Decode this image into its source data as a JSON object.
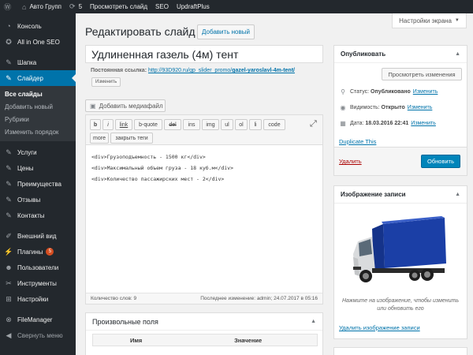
{
  "adminbar": {
    "site_name": "Авто Групп",
    "updates_count": "5",
    "view_slide": "Просмотреть слайд",
    "seo": "SEO",
    "updraft": "UpdraftPlus"
  },
  "sidebar": {
    "items": [
      {
        "label": "Консоль",
        "icon": "dashboard-icon"
      },
      {
        "label": "All in One SEO",
        "icon": "seo-icon"
      },
      {
        "label": "Шапка",
        "icon": "header-icon"
      },
      {
        "label": "Слайдер",
        "icon": "slider-icon"
      },
      {
        "label": "Услуги",
        "icon": "pin-icon"
      },
      {
        "label": "Цены",
        "icon": "pin-icon"
      },
      {
        "label": "Преимущества",
        "icon": "pin-icon"
      },
      {
        "label": "Отзывы",
        "icon": "pin-icon"
      },
      {
        "label": "Контакты",
        "icon": "pin-icon"
      },
      {
        "label": "Внешний вид",
        "icon": "appearance-icon"
      },
      {
        "label": "Плагины",
        "icon": "plugins-icon",
        "badge": "5"
      },
      {
        "label": "Пользователи",
        "icon": "users-icon"
      },
      {
        "label": "Инструменты",
        "icon": "tools-icon"
      },
      {
        "label": "Настройки",
        "icon": "settings-icon"
      },
      {
        "label": "FileManager",
        "icon": "filemanager-icon"
      },
      {
        "label": "Свернуть меню",
        "icon": "collapse-icon"
      }
    ],
    "submenu": [
      "Все слайды",
      "Добавить новый",
      "Рубрики",
      "Изменить порядок"
    ]
  },
  "screen_options": "Настройки экрана",
  "page": {
    "title": "Редактировать слайд",
    "add_new": "Добавить новый"
  },
  "post": {
    "title": "Удлиненная газель (4м) тент",
    "permalink_label": "Постоянная ссылка:",
    "permalink_url": "http://93D920.ru/gp_slider_promo/",
    "permalink_slug": "gazel-yaroslavl-4m-tent/",
    "edit_slug": "Изменить"
  },
  "editor": {
    "add_media": "Добавить медиафайл",
    "buttons": [
      "b",
      "i",
      "link",
      "b-quote",
      "del",
      "ins",
      "img",
      "ul",
      "ol",
      "li",
      "code",
      "more",
      "закрыть теги"
    ],
    "content_lines": [
      "<div>Грузоподъемность - 1500 кг</div>",
      "<div>Максимальный объем груза - 18 куб.м</div>",
      "<div>Количество пассажирских мест - 2</div>"
    ],
    "word_count": "Количество слов: 9",
    "last_edit": "Последнее изменение: admin; 24.07.2017 в 05:16"
  },
  "custom_fields": {
    "title": "Произвольные поля",
    "col_name": "Имя",
    "col_value": "Значение"
  },
  "publish": {
    "title": "Опубликовать",
    "preview": "Просмотреть изменения",
    "status_label": "Статус:",
    "status_value": "Опубликовано",
    "visibility_label": "Видимость:",
    "visibility_value": "Открыто",
    "date_label": "Дата:",
    "date_value": "18.03.2016 22:41",
    "edit_link": "Изменить",
    "duplicate": "Duplicate This",
    "trash": "Удалить",
    "update": "Обновить"
  },
  "thumbnail": {
    "title": "Изображение записи",
    "hint": "Нажмите на изображение, чтобы изменить или обновить его",
    "remove": "Удалить изображение записи"
  }
}
